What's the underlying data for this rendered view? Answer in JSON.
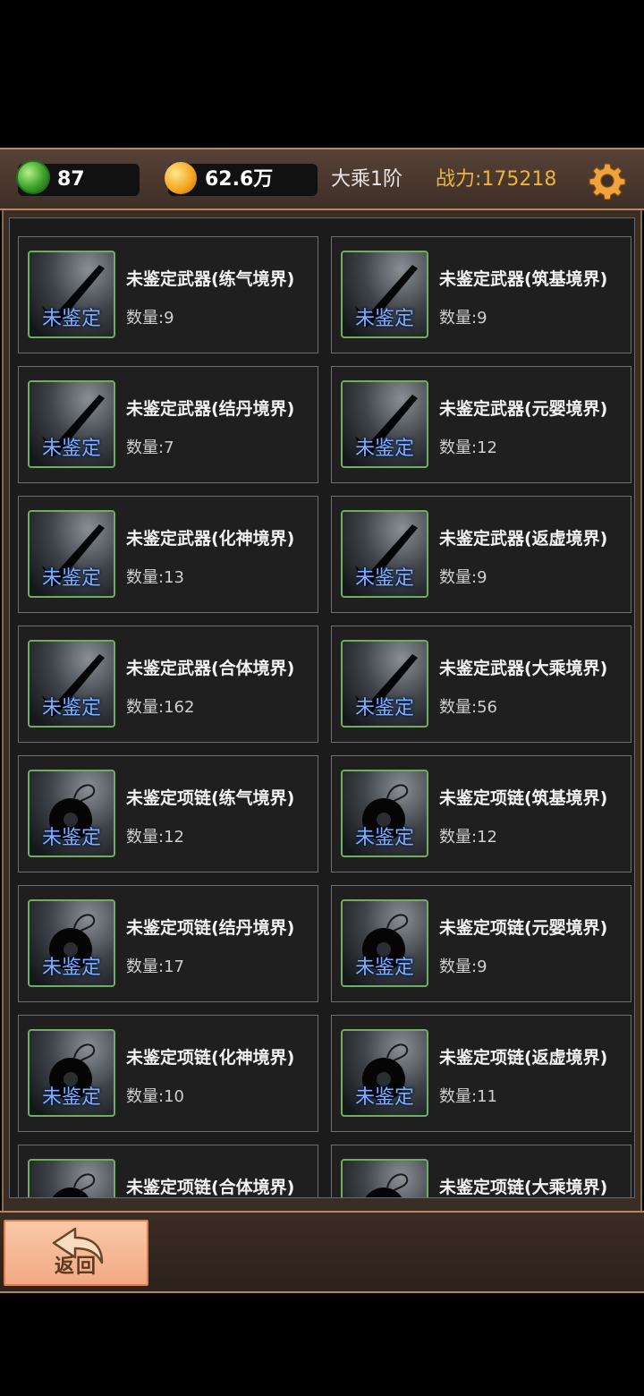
{
  "header": {
    "jade_count": "87",
    "gold_amount": "62.6万",
    "realm": "大乘1阶",
    "power": "战力:175218"
  },
  "items": [
    {
      "name": "未鉴定武器(练气境界)",
      "qty": "数量:9",
      "kind": "weapon",
      "badge": "未鉴定"
    },
    {
      "name": "未鉴定武器(筑基境界)",
      "qty": "数量:9",
      "kind": "weapon",
      "badge": "未鉴定"
    },
    {
      "name": "未鉴定武器(结丹境界)",
      "qty": "数量:7",
      "kind": "weapon",
      "badge": "未鉴定"
    },
    {
      "name": "未鉴定武器(元婴境界)",
      "qty": "数量:12",
      "kind": "weapon",
      "badge": "未鉴定"
    },
    {
      "name": "未鉴定武器(化神境界)",
      "qty": "数量:13",
      "kind": "weapon",
      "badge": "未鉴定"
    },
    {
      "name": "未鉴定武器(返虚境界)",
      "qty": "数量:9",
      "kind": "weapon",
      "badge": "未鉴定"
    },
    {
      "name": "未鉴定武器(合体境界)",
      "qty": "数量:162",
      "kind": "weapon",
      "badge": "未鉴定"
    },
    {
      "name": "未鉴定武器(大乘境界)",
      "qty": "数量:56",
      "kind": "weapon",
      "badge": "未鉴定"
    },
    {
      "name": "未鉴定项链(练气境界)",
      "qty": "数量:12",
      "kind": "necklace",
      "badge": "未鉴定"
    },
    {
      "name": "未鉴定项链(筑基境界)",
      "qty": "数量:12",
      "kind": "necklace",
      "badge": "未鉴定"
    },
    {
      "name": "未鉴定项链(结丹境界)",
      "qty": "数量:17",
      "kind": "necklace",
      "badge": "未鉴定"
    },
    {
      "name": "未鉴定项链(元婴境界)",
      "qty": "数量:9",
      "kind": "necklace",
      "badge": "未鉴定"
    },
    {
      "name": "未鉴定项链(化神境界)",
      "qty": "数量:10",
      "kind": "necklace",
      "badge": "未鉴定"
    },
    {
      "name": "未鉴定项链(返虚境界)",
      "qty": "数量:11",
      "kind": "necklace",
      "badge": "未鉴定"
    },
    {
      "name": "未鉴定项链(合体境界)",
      "qty": "",
      "kind": "necklace",
      "badge": ""
    },
    {
      "name": "未鉴定项链(大乘境界)",
      "qty": "",
      "kind": "necklace",
      "badge": ""
    }
  ],
  "footer": {
    "back_label": "返回"
  }
}
